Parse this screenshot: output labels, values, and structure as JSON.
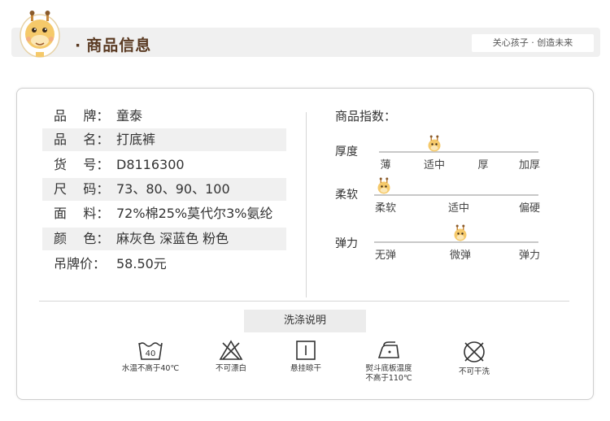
{
  "header": {
    "title": "商品信息",
    "slogan": "关心孩子 · 创造未来"
  },
  "specs": [
    {
      "label": "品    牌：",
      "value": "童泰",
      "shaded": false
    },
    {
      "label": "品    名：",
      "value": "打底裤",
      "shaded": true
    },
    {
      "label": "货    号：",
      "value": "D8116300",
      "shaded": false
    },
    {
      "label": "尺    码：",
      "value": " 73、80、90、100",
      "shaded": true
    },
    {
      "label": "面    料：",
      "value": " 72%棉25%莫代尔3%氨纶",
      "shaded": false
    },
    {
      "label": "颜    色：",
      "value": "麻灰色 深蓝色 粉色",
      "shaded": true
    },
    {
      "label": "吊牌价：",
      "value": "58.50元",
      "shaded": false
    }
  ],
  "indices": {
    "title": "商品指数：",
    "scales": [
      {
        "label": "厚度",
        "ticks": [
          "薄",
          "适中",
          "厚",
          "加厚"
        ],
        "selected": "适中"
      },
      {
        "label": "柔软",
        "ticks": [
          "柔软",
          "适中",
          "偏硬"
        ],
        "selected": "柔软"
      },
      {
        "label": "弹力",
        "ticks": [
          "无弹",
          "微弹",
          "弹力"
        ],
        "selected": "微弹"
      }
    ]
  },
  "wash": {
    "title": "洗涤说明",
    "items": [
      {
        "icon": "wash-40-icon",
        "text": "水温不高于40℃",
        "tub_label": "40"
      },
      {
        "icon": "no-bleach-icon",
        "text": "不可漂白"
      },
      {
        "icon": "hang-dry-icon",
        "text": "悬挂晾干"
      },
      {
        "icon": "iron-icon",
        "text": "熨斗底板温度\n不高于110℃"
      },
      {
        "icon": "no-dry-clean-icon",
        "text": "不可干洗"
      }
    ]
  },
  "colors": {
    "accent_brown": "#5a3a22",
    "header_bg": "#f0f0f0",
    "row_shade": "#f0f0f0",
    "track": "#c8c8c8"
  }
}
